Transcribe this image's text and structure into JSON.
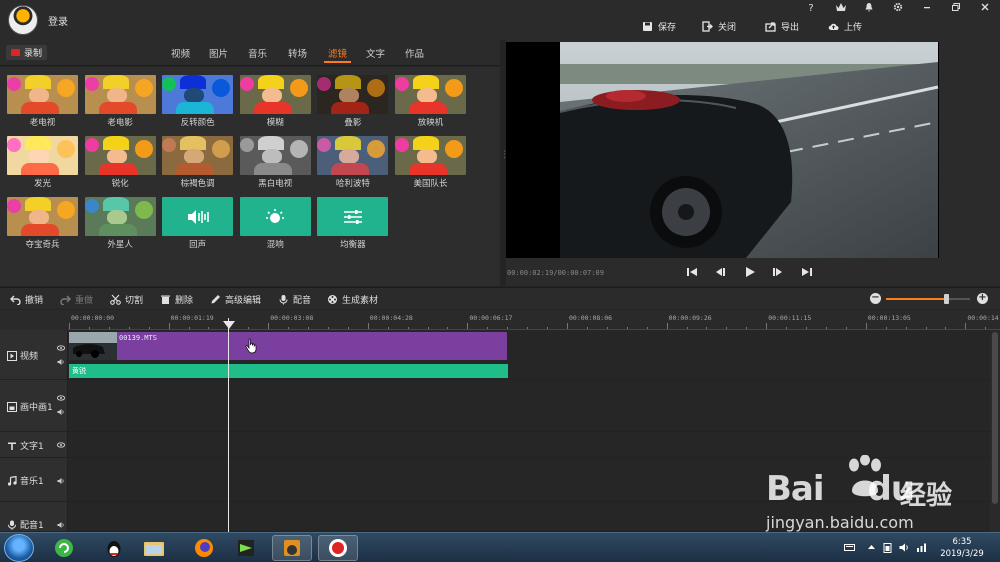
{
  "titlebar": {
    "login": "登录",
    "save": "保存",
    "close": "关闭",
    "export": "导出",
    "upload": "上传",
    "help": "?"
  },
  "tabs": {
    "record": "录制",
    "items": [
      "视频",
      "图片",
      "音乐",
      "转场",
      "滤镜",
      "文字",
      "作品"
    ],
    "active": "滤镜"
  },
  "filters": [
    {
      "label": "老电视",
      "style": "warm"
    },
    {
      "label": "老电影",
      "style": "warm"
    },
    {
      "label": "反转颜色",
      "style": "invert"
    },
    {
      "label": "模糊",
      "style": "normal"
    },
    {
      "label": "叠影",
      "style": "dark"
    },
    {
      "label": "放映机",
      "style": "normal"
    },
    {
      "label": "发光",
      "style": "bright"
    },
    {
      "label": "锐化",
      "style": "normal"
    },
    {
      "label": "棕褐色调",
      "style": "sepia"
    },
    {
      "label": "黑白电视",
      "style": "gray"
    },
    {
      "label": "哈利波特",
      "style": "cool"
    },
    {
      "label": "美国队长",
      "style": "normal"
    },
    {
      "label": "夺宝奇兵",
      "style": "warm"
    },
    {
      "label": "外星人",
      "style": "alien"
    },
    {
      "label": "回声",
      "style": "echo-icon"
    },
    {
      "label": "混响",
      "style": "reverb-icon"
    },
    {
      "label": "均衡器",
      "style": "equalizer-icon"
    }
  ],
  "preview": {
    "timecode": "00:00:02:19/00:00:07:09"
  },
  "toolbar": {
    "undo": "撤销",
    "redo": "重做",
    "cut": "切割",
    "delete": "删除",
    "advanced_edit": "高级编辑",
    "dub": "配音",
    "generate": "生成素材",
    "zoom_level": 0.72
  },
  "ruler": [
    "00:00:00:00",
    "00:00:01:19",
    "00:00:03:08",
    "00:00:04:28",
    "00:00:06:17",
    "00:00:08:06",
    "00:00:09:26",
    "00:00:11:15",
    "00:00:13:05",
    "00:00:14:"
  ],
  "tracks": {
    "video": "视频",
    "pip": "画中画1",
    "text": "文字1",
    "music": "音乐1",
    "dub": "配音1"
  },
  "clips": {
    "video_clip": "00139.MTS",
    "filter_clip": "黄锐"
  },
  "watermark": {
    "logo": "Bai",
    "logo_tail": "du",
    "cn": "经验",
    "url": "jingyan.baidu.com"
  },
  "taskbar": {
    "time": "6:35",
    "date": "2019/3/29"
  },
  "colors": {
    "accent": "#ff7a1a",
    "clip_purple": "#7b3fa0",
    "filter_green": "#1ebd8a",
    "teal_tile": "#21b38e",
    "record_red": "#e02323"
  }
}
